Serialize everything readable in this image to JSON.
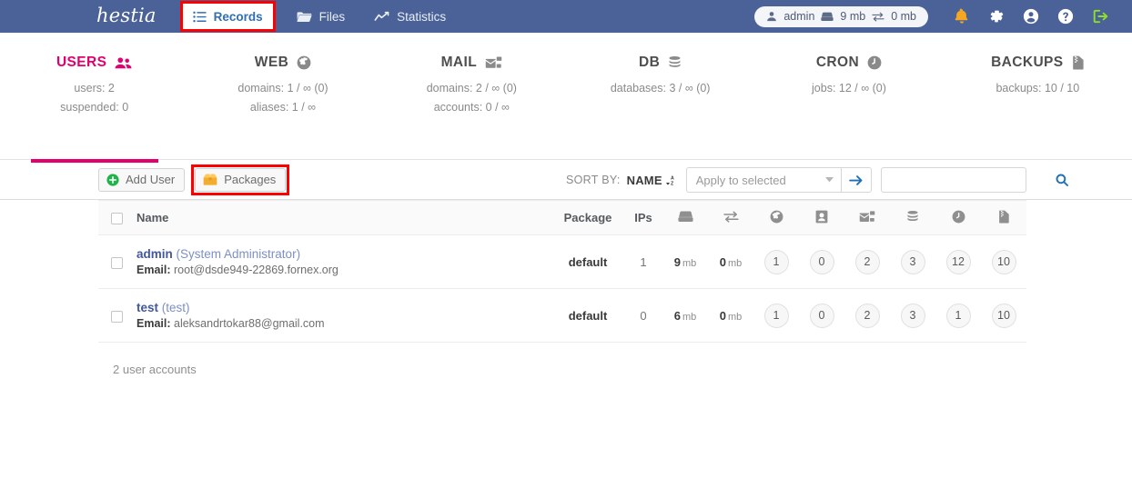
{
  "topnav": {
    "brand": "hestia",
    "items": [
      {
        "label": "Records",
        "icon": "list-check-icon",
        "active": true,
        "highlighted": true
      },
      {
        "label": "Files",
        "icon": "folder-icon",
        "active": false,
        "highlighted": false
      },
      {
        "label": "Statistics",
        "icon": "chart-line-icon",
        "active": false,
        "highlighted": false
      }
    ],
    "user_chip": {
      "user": "admin",
      "disk": "9 mb",
      "bandwidth": "0 mb"
    },
    "icons": [
      {
        "name": "bell-icon",
        "color": "#f5a623"
      },
      {
        "name": "gear-icon",
        "color": "#ffffff"
      },
      {
        "name": "user-circle-icon",
        "color": "#ffffff"
      },
      {
        "name": "help-circle-icon",
        "color": "#ffffff"
      },
      {
        "name": "logout-icon",
        "color": "#7ed321"
      }
    ]
  },
  "stats": [
    {
      "title": "USERS",
      "icon": "users-icon",
      "active": true,
      "lines": [
        "users: 2",
        "suspended: 0"
      ]
    },
    {
      "title": "WEB",
      "icon": "globe-icon",
      "active": false,
      "lines": [
        "domains: 1 / ∞ (0)",
        "aliases: 1 / ∞"
      ]
    },
    {
      "title": "MAIL",
      "icon": "mail-icon",
      "active": false,
      "lines": [
        "domains: 2 / ∞ (0)",
        "accounts: 0 / ∞"
      ]
    },
    {
      "title": "DB",
      "icon": "database-icon",
      "active": false,
      "lines": [
        "databases: 3 / ∞ (0)"
      ]
    },
    {
      "title": "CRON",
      "icon": "clock-icon",
      "active": false,
      "lines": [
        "jobs: 12 / ∞ (0)"
      ]
    },
    {
      "title": "BACKUPS",
      "icon": "archive-file-icon",
      "active": false,
      "lines": [
        "backups: 10 / 10"
      ]
    }
  ],
  "toolbar": {
    "add_user_label": "Add User",
    "packages_label": "Packages",
    "sort_by_label": "SORT BY:",
    "sort_value": "NAME",
    "apply_placeholder": "Apply to selected",
    "search_value": "",
    "search_placeholder": ""
  },
  "table": {
    "headers": {
      "name": "Name",
      "package": "Package",
      "ips": "IPs",
      "disk_icon": "hdd-icon",
      "bandwidth_icon": "exchange-icon",
      "web_icon": "globe-icon",
      "dns_icon": "id-card-icon",
      "mail_icon": "mail-icon",
      "db_icon": "database-icon",
      "cron_icon": "clock-icon",
      "backup_icon": "archive-file-icon"
    },
    "rows": [
      {
        "user": "admin",
        "fullname": "(System Administrator)",
        "email_label": "Email:",
        "email": "root@dsde949-22869.fornex.org",
        "package": "default",
        "ips": "1",
        "disk_value": "9",
        "disk_unit": "mb",
        "bw_value": "0",
        "bw_unit": "mb",
        "web": "1",
        "dns": "0",
        "mail": "2",
        "db": "3",
        "cron": "12",
        "backup": "10"
      },
      {
        "user": "test",
        "fullname": "(test)",
        "email_label": "Email:",
        "email": "aleksandrtokar88@gmail.com",
        "package": "default",
        "ips": "0",
        "disk_value": "6",
        "disk_unit": "mb",
        "bw_value": "0",
        "bw_unit": "mb",
        "web": "1",
        "dns": "0",
        "mail": "2",
        "db": "3",
        "cron": "1",
        "backup": "10"
      }
    ]
  },
  "footer": {
    "count_text": "2 user accounts"
  },
  "colors": {
    "header_bg": "#4a6298",
    "accent_pink": "#e3006e",
    "highlight_red": "#ff0000",
    "link_blue": "#43579c"
  }
}
